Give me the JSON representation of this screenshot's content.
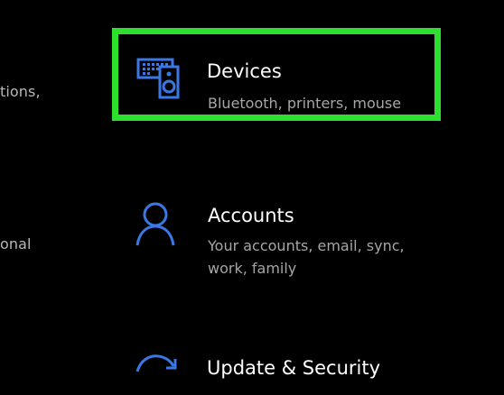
{
  "colors": {
    "background": "#000000",
    "accent_blue": "#3a78e6",
    "highlight_green": "#2ee02e",
    "title_text": "#ffffff",
    "desc_text": "#a6a6a6"
  },
  "left_column": {
    "fragment_1": "tions,",
    "fragment_2": "onal"
  },
  "tiles": [
    {
      "title": "Devices",
      "description": "Bluetooth, printers, mouse",
      "icon": "devices-icon",
      "highlighted": true
    },
    {
      "title": "Accounts",
      "description": "Your accounts, email, sync, work, family",
      "icon": "person-icon"
    },
    {
      "title": "Update & Security",
      "description": "",
      "icon": "sync-icon"
    }
  ]
}
